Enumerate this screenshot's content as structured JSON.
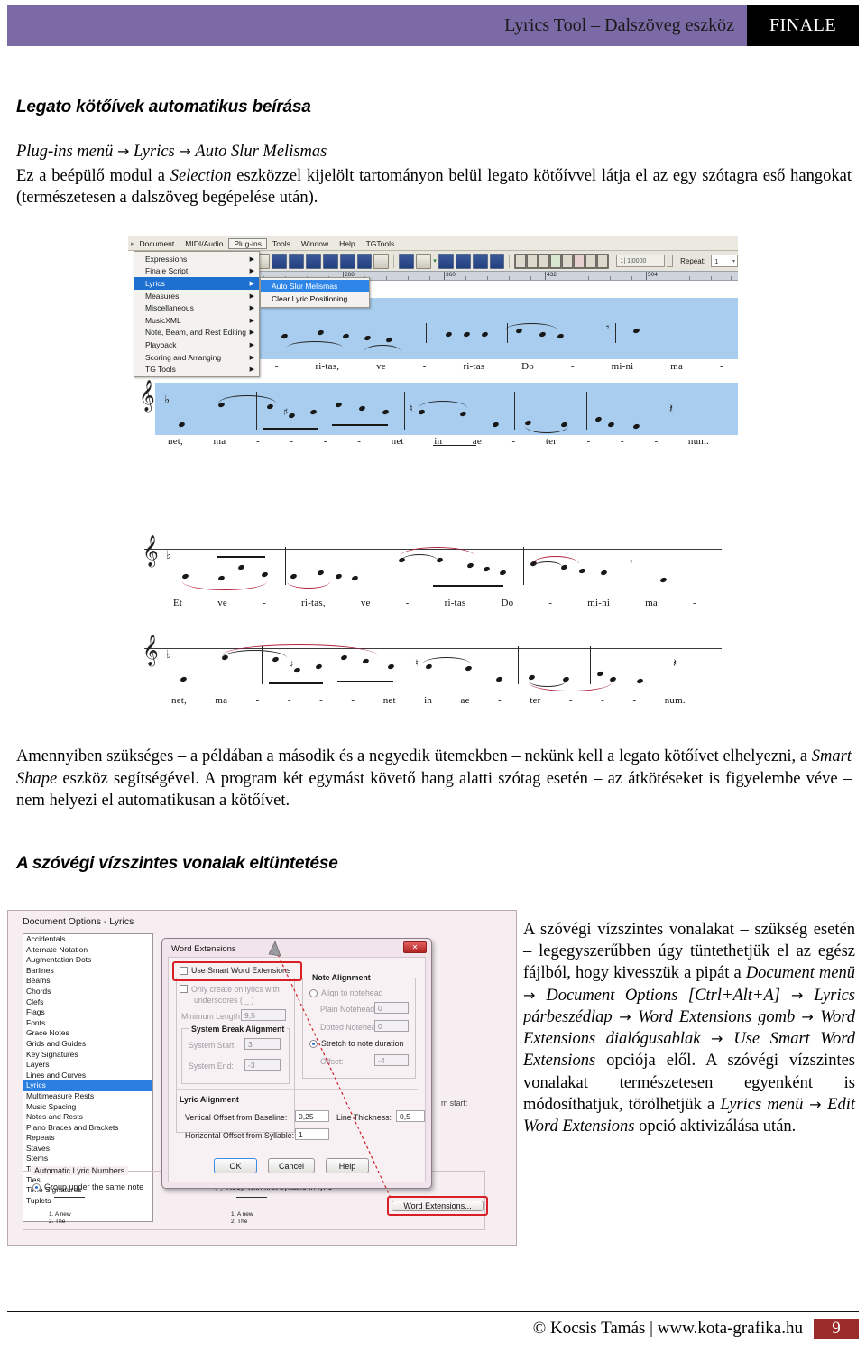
{
  "header": {
    "title": "Lyrics Tool – Dalszöveg eszköz",
    "brand": "FINALE"
  },
  "section1": {
    "title": "Legato kötőívek automatikus beírása",
    "path_pre": "Plug-ins menü",
    "path_a": "Lyrics",
    "path_b": "Auto Slur Melismas",
    "arrow": "→",
    "para_1a": "Ez a beépülő modul a ",
    "para_1b": "Selection",
    "para_1c": " eszközzel kijelölt tartományon belül legato kötőívvel látja el az egy szótagra eső hangokat (természetesen a dalszöveg begépelése után)."
  },
  "finale": {
    "menubar": [
      {
        "label": "Document",
        "active": false
      },
      {
        "label": "MIDI/Audio",
        "active": false
      },
      {
        "label": "Plug-ins",
        "active": true
      },
      {
        "label": "Tools",
        "active": false
      },
      {
        "label": "Window",
        "active": false
      },
      {
        "label": "Help",
        "active": false
      },
      {
        "label": "TGTools",
        "active": false
      }
    ],
    "plugins_menu": [
      "Expressions",
      "Finale Script",
      "Lyrics",
      "Measures",
      "Miscellaneous",
      "MusicXML",
      "Note, Beam, and Rest Editing",
      "Playback",
      "Scoring and Arranging",
      "TG Tools"
    ],
    "plugins_selected": "Lyrics",
    "submenu": [
      {
        "label": "Auto Slur Melismas",
        "selected": true
      },
      {
        "label": "Clear Lyric Positioning...",
        "selected": false
      }
    ],
    "transport_value": "1| 1|0000",
    "repeat_label": "Repeat:",
    "repeat_value": "1",
    "ruler_ticks": [
      "288",
      "360",
      "432",
      "504"
    ],
    "selection_color": "#a8cdee"
  },
  "music": {
    "system1_lyrics": [
      "Et",
      "ve",
      "-",
      "ri-tas,",
      "ve",
      "-",
      "ri-tas",
      "Do",
      "-",
      "mi-ni",
      "ma",
      "-"
    ],
    "system2_lyrics": [
      "net,",
      "ma",
      "-",
      "-",
      "-",
      "-",
      "net",
      "in",
      "ae",
      "-",
      "ter",
      "-",
      "-",
      "-",
      "num."
    ],
    "slur_color": "#b01f3c",
    "key": "b",
    "clef": "treble"
  },
  "section2": {
    "para_2a": "Amennyiben szükséges – a példában a második és a negyedik ütemekben – nekünk kell a legato kötőívet elhelyezni, a ",
    "para_2b": "Smart Shape",
    "para_2c": " eszköz segítségével. A program két egymást követő hang alatti szótag esetén – az átkötéseket is figyelembe véve – nem helyezi el automatikusan a kötőívet.",
    "title": "A szóvégi vízszintes vonalak eltüntetése"
  },
  "doc_options": {
    "title": "Document Options - Lyrics",
    "categories": [
      "Accidentals",
      "Alternate Notation",
      "Augmentation Dots",
      "Barlines",
      "Beams",
      "Chords",
      "Clefs",
      "Flags",
      "Fonts",
      "Grace Notes",
      "Grids and Guides",
      "Key Signatures",
      "Layers",
      "Lines and Curves",
      "Lyrics",
      "Multimeasure Rests",
      "Music Spacing",
      "Notes and Rests",
      "Piano Braces and Brackets",
      "Repeats",
      "Staves",
      "Stems",
      "Text",
      "Ties",
      "Time Signatures",
      "Tuplets"
    ],
    "selected_category": "Lyrics",
    "lyric_numbers_group": "Automatic Lyric Numbers",
    "radio_group_under": "Group under the same note",
    "radio_keep_first": "Keep with first syllable in lyric",
    "mini_ex1_l1": "1. A  new",
    "mini_ex1_l2": "2.     The",
    "mini_ex2_l1": "1. A  new",
    "mini_ex2_l2": "2. The",
    "word_extensions_button": "Word Extensions..."
  },
  "word_extensions": {
    "title": "Word Extensions",
    "close_glyph": "✕",
    "use_smart": "Use Smart Word Extensions",
    "only_create_l1": "Only create on lyrics with",
    "only_create_l2": "underscores ( _ )",
    "minimum_length_label": "Minimum Length:",
    "minimum_length_value": "9,5",
    "system_break_group": "System Break Alignment",
    "system_start_label": "System Start:",
    "system_start_value": "3",
    "system_end_label": "System End:",
    "system_end_value": "-3",
    "note_alignment_group": "Note Alignment",
    "align_to_notehead": "Align to notehead",
    "plain_notehead_label": "Plain Notehead:",
    "plain_notehead_value": "0",
    "dotted_notehead_label": "Dotted Notehead:",
    "dotted_notehead_value": "0",
    "stretch_to_duration": "Stretch to note duration",
    "offset_label": "Offset:",
    "offset_value": "-4",
    "lyric_alignment_group": "Lyric Alignment",
    "vertical_offset_label": "Vertical Offset from Baseline:",
    "vertical_offset_value": "0,25",
    "line_thickness_label": "Line Thickness:",
    "line_thickness_value": "0,5",
    "horizontal_offset_label": "Horizontal Offset from Syllable:",
    "horizontal_offset_value": "1",
    "system_start_right_label": "m start:",
    "ok": "OK",
    "cancel": "Cancel",
    "help": "Help"
  },
  "rightcol": {
    "t1": "A szóvégi vízszintes vonalakat – szükség esetén – legegyszerűbben úgy tüntethetjük el az egész fájlból, hogy kivesszük a pipát a ",
    "i1": "Document menü",
    "a1": " → ",
    "i2": "Document Options [Ctrl+Alt+A]",
    "a2": " → ",
    "i3": "Lyrics párbeszédlap",
    "a3": " → ",
    "i4": "Word Extensions",
    "t2": " gomb ",
    "a4": "→ ",
    "i5": "Word Extensions",
    "t3": " dialógusablak ",
    "a5": "→ ",
    "i6": "Use Smart Word Extensions",
    "t4": " opciója elől. A szóvégi vízszintes vonalakat természetesen egyenként is módosíthatjuk, törölhetjük a ",
    "i7": "Lyrics menü",
    "a6": " → ",
    "i8": "Edit Word Extensions",
    "t5": " opció aktivizálása után."
  },
  "footer": {
    "text": "© Kocsis Tamás | www.kota-grafika.hu",
    "page": "9"
  }
}
